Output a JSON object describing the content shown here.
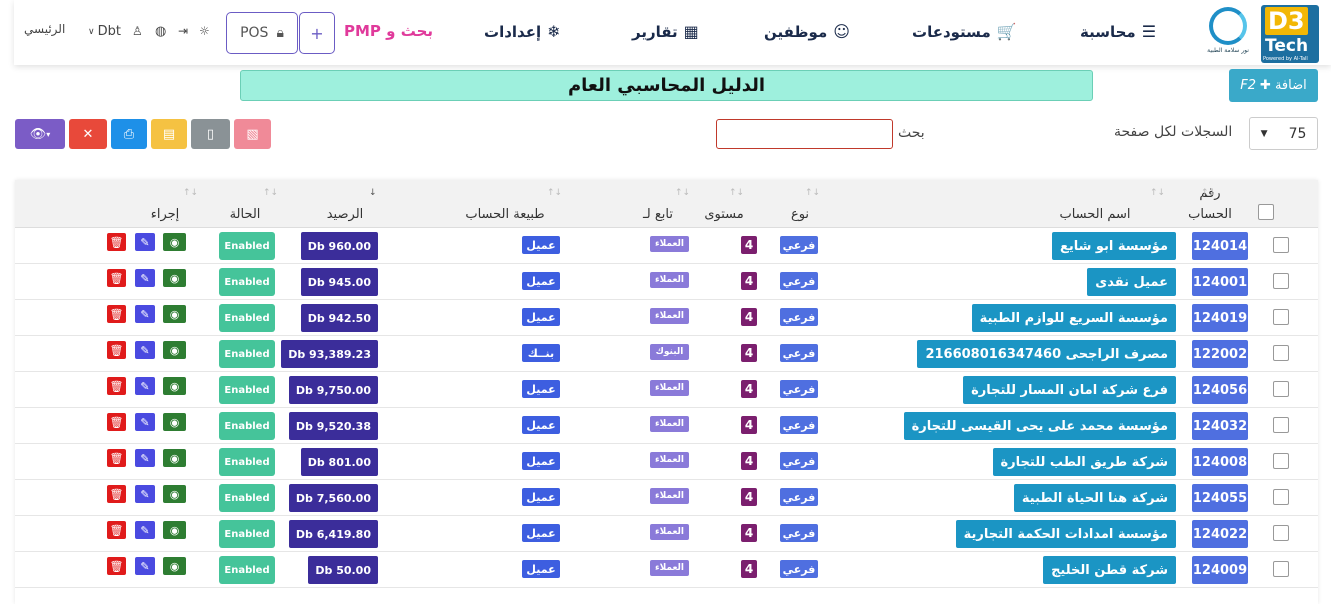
{
  "header": {
    "logo_d3_big": "D3",
    "logo_d3_tech": "Tech",
    "logo_d3_powered": "Powered by Al-Tall",
    "logo_noor_text": "نور سلامة الطبية",
    "nav": {
      "accounting": "محاسبة",
      "warehouses": "مستودعات",
      "employees": "موظفين",
      "reports": "تقارير",
      "settings": "إعدادات",
      "search_pmp": "بحث و PMP"
    },
    "plus_label": "+",
    "pos_label": "POS",
    "currency": "Dbt",
    "home": "الرئيسي"
  },
  "page": {
    "title": "الدليل المحاسبي العام",
    "add_label": "اضافة",
    "add_shortcut": "F2",
    "search_label": "بحث",
    "search_value": "",
    "per_page_label": "السجلات لكل صفحة",
    "per_page_value": "75"
  },
  "table": {
    "headers": {
      "number_line1": "رقم",
      "number_line2": "الحساب",
      "name": "اسم الحساب",
      "type": "نوع",
      "level": "مستوى",
      "parent": "تابع لـ",
      "nature": "طبيعة الحساب",
      "balance": "الرصيد",
      "status": "الحالة",
      "action": "إجراء"
    },
    "rows": [
      {
        "num": "124014",
        "name": "مؤسسة ابو شايع",
        "type": "فرعي",
        "level": "4",
        "parent": "العملاء",
        "nature": "عميل",
        "balance": "Db 960.00",
        "status": "Enabled"
      },
      {
        "num": "124001",
        "name": "عميل نقدى",
        "type": "فرعي",
        "level": "4",
        "parent": "العملاء",
        "nature": "عميل",
        "balance": "Db 945.00",
        "status": "Enabled"
      },
      {
        "num": "124019",
        "name": "مؤسسة السريع للوازم الطبية",
        "type": "فرعي",
        "level": "4",
        "parent": "العملاء",
        "nature": "عميل",
        "balance": "Db 942.50",
        "status": "Enabled"
      },
      {
        "num": "122002",
        "name": "مصرف الراجحى 216608016347460",
        "type": "فرعي",
        "level": "4",
        "parent": "البنوك",
        "nature": "بنــك",
        "balance": "Db 93,389.23",
        "status": "Enabled"
      },
      {
        "num": "124056",
        "name": "فرع شركة امان المسار للتجارة",
        "type": "فرعي",
        "level": "4",
        "parent": "العملاء",
        "nature": "عميل",
        "balance": "Db 9,750.00",
        "status": "Enabled"
      },
      {
        "num": "124032",
        "name": "مؤسسة محمد على يحى القيسى للتجارة",
        "type": "فرعي",
        "level": "4",
        "parent": "العملاء",
        "nature": "عميل",
        "balance": "Db 9,520.38",
        "status": "Enabled"
      },
      {
        "num": "124008",
        "name": "شركة طريق الطب للتجارة",
        "type": "فرعي",
        "level": "4",
        "parent": "العملاء",
        "nature": "عميل",
        "balance": "Db 801.00",
        "status": "Enabled"
      },
      {
        "num": "124055",
        "name": "شركة هنا الحياة الطبية",
        "type": "فرعي",
        "level": "4",
        "parent": "العملاء",
        "nature": "عميل",
        "balance": "Db 7,560.00",
        "status": "Enabled"
      },
      {
        "num": "124022",
        "name": "مؤسسة امدادات الحكمة التجارية",
        "type": "فرعي",
        "level": "4",
        "parent": "العملاء",
        "nature": "عميل",
        "balance": "Db 6,419.80",
        "status": "Enabled"
      },
      {
        "num": "124009",
        "name": "شركة قطن الخليج",
        "type": "فرعي",
        "level": "4",
        "parent": "العملاء",
        "nature": "عميل",
        "balance": "Db 50.00",
        "status": "Enabled"
      }
    ]
  }
}
